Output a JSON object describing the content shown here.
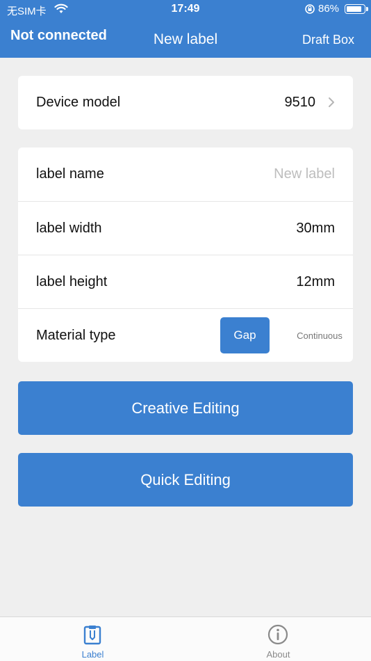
{
  "status_bar": {
    "carrier": "无SIM卡",
    "time": "17:49",
    "battery": "86%"
  },
  "nav": {
    "connection": "Not connected",
    "title": "New label",
    "draft": "Draft Box"
  },
  "device": {
    "label": "Device model",
    "value": "9510"
  },
  "form": {
    "name_label": "label name",
    "name_placeholder": "New label",
    "width_label": "label width",
    "width_value": "30mm",
    "height_label": "label height",
    "height_value": "12mm",
    "material_label": "Material type",
    "material_options": [
      "Gap",
      "Continuous"
    ],
    "material_selected": "Gap"
  },
  "actions": {
    "creative": "Creative Editing",
    "quick": "Quick Editing"
  },
  "tabs": [
    {
      "label": "Label",
      "icon": "clipboard-icon",
      "active": true
    },
    {
      "label": "About",
      "icon": "info-icon",
      "active": false
    }
  ],
  "colors": {
    "accent": "#3b80d0",
    "background": "#efefef"
  }
}
